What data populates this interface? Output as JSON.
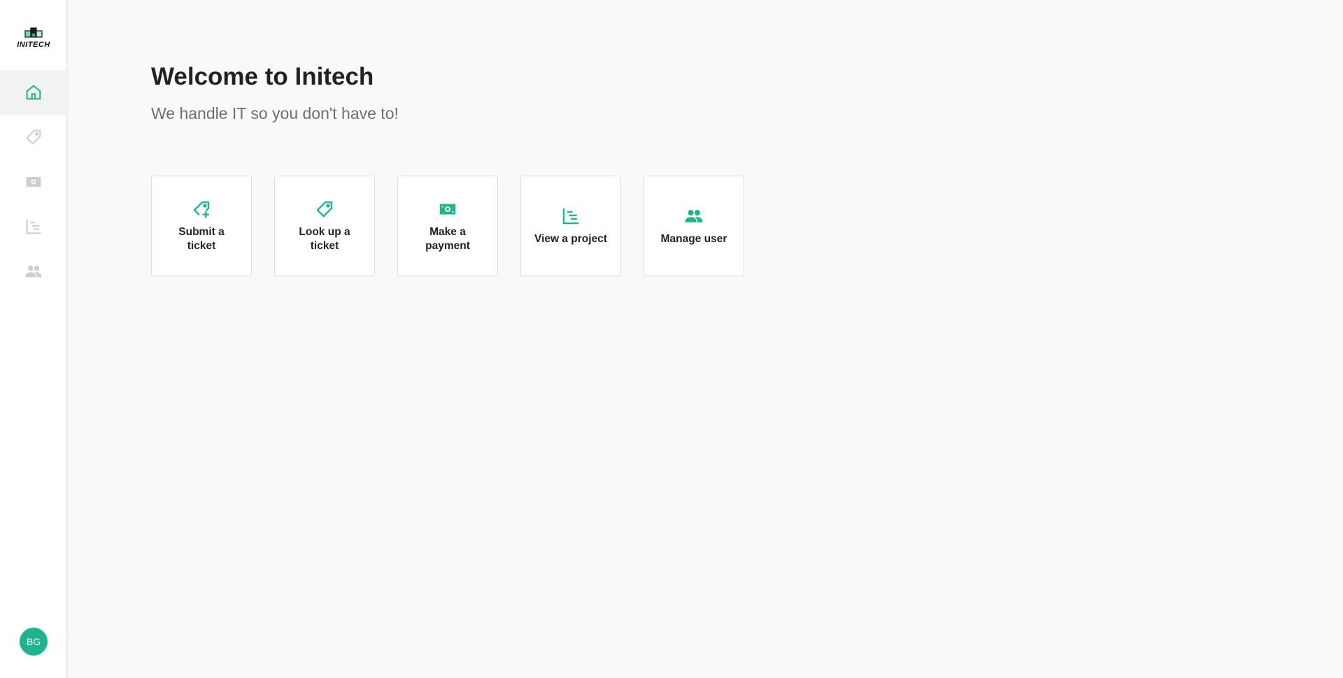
{
  "brand": {
    "name": "INITECH"
  },
  "colors": {
    "accent": "#1fb58c",
    "icon_inactive": "#cfcfcf"
  },
  "sidebar": {
    "items": [
      {
        "id": "home",
        "icon": "home-icon",
        "active": true
      },
      {
        "id": "tickets",
        "icon": "tag-icon",
        "active": false
      },
      {
        "id": "payments",
        "icon": "banknote-icon",
        "active": false
      },
      {
        "id": "projects",
        "icon": "gantt-chart-icon",
        "active": false
      },
      {
        "id": "users",
        "icon": "people-icon",
        "active": false
      }
    ],
    "user_initials": "BG"
  },
  "main": {
    "title": "Welcome to Initech",
    "subtitle": "We handle IT so you don't have to!",
    "actions": [
      {
        "label": "Submit a ticket",
        "icon": "tag-plus-icon"
      },
      {
        "label": "Look up a ticket",
        "icon": "tag-icon"
      },
      {
        "label": "Make a payment",
        "icon": "banknote-icon"
      },
      {
        "label": "View a project",
        "icon": "gantt-chart-icon"
      },
      {
        "label": "Manage user",
        "icon": "people-icon"
      }
    ]
  }
}
